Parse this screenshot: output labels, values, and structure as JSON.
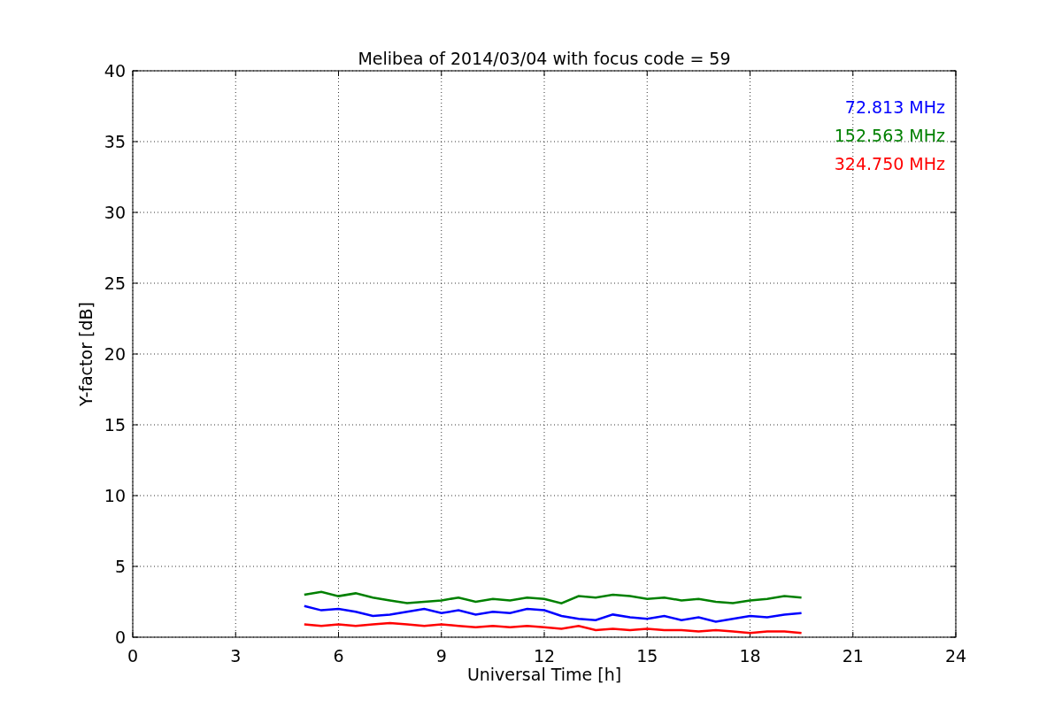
{
  "figure": {
    "chart_data": {
      "type": "line",
      "title": "Melibea of 2014/03/04 with focus code = 59",
      "xlabel": "Universal Time [h]",
      "ylabel": "Y-factor [dB]",
      "x": [
        5,
        5.5,
        6,
        6.5,
        7,
        7.5,
        8,
        8.5,
        9,
        9.5,
        10,
        10.5,
        11,
        11.5,
        12,
        12.5,
        13,
        13.5,
        14,
        14.5,
        15,
        15.5,
        16,
        16.5,
        17,
        17.5,
        18,
        18.5,
        19,
        19.5
      ],
      "series": [
        {
          "name": "72.813 MHz",
          "color": "#0000ff",
          "values": [
            2.2,
            1.9,
            2.0,
            1.8,
            1.5,
            1.6,
            1.8,
            2.0,
            1.7,
            1.9,
            1.6,
            1.8,
            1.7,
            2.0,
            1.9,
            1.5,
            1.3,
            1.2,
            1.6,
            1.4,
            1.3,
            1.5,
            1.2,
            1.4,
            1.1,
            1.3,
            1.5,
            1.4,
            1.6,
            1.7
          ]
        },
        {
          "name": "152.563 MHz",
          "color": "#008000",
          "values": [
            3.0,
            3.2,
            2.9,
            3.1,
            2.8,
            2.6,
            2.4,
            2.5,
            2.6,
            2.8,
            2.5,
            2.7,
            2.6,
            2.8,
            2.7,
            2.4,
            2.9,
            2.8,
            3.0,
            2.9,
            2.7,
            2.8,
            2.6,
            2.7,
            2.5,
            2.4,
            2.6,
            2.7,
            2.9,
            2.8
          ]
        },
        {
          "name": "324.750 MHz",
          "color": "#ff0000",
          "values": [
            0.9,
            0.8,
            0.9,
            0.8,
            0.9,
            1.0,
            0.9,
            0.8,
            0.9,
            0.8,
            0.7,
            0.8,
            0.7,
            0.8,
            0.7,
            0.6,
            0.8,
            0.5,
            0.6,
            0.5,
            0.6,
            0.5,
            0.5,
            0.4,
            0.5,
            0.4,
            0.3,
            0.4,
            0.4,
            0.3
          ]
        }
      ],
      "xlim": [
        0,
        24
      ],
      "ylim": [
        0,
        40
      ],
      "xticks": [
        0,
        3,
        6,
        9,
        12,
        15,
        18,
        21,
        24
      ],
      "yticks": [
        0,
        5,
        10,
        15,
        20,
        25,
        30,
        35,
        40
      ],
      "grid": true
    }
  }
}
